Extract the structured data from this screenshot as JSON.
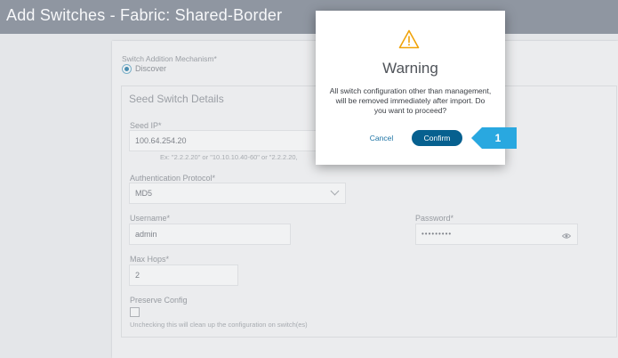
{
  "header": {
    "title": "Add Switches - Fabric: Shared-Border"
  },
  "form": {
    "mechanism_label": "Switch Addition Mechanism*",
    "mechanism_option": "Discover",
    "section_title": "Seed Switch Details",
    "seed_ip_label": "Seed IP*",
    "seed_ip_value": "100.64.254.20",
    "seed_ip_hint": "Ex: \"2.2.2.20\" or \"10.10.10.40-60\" or \"2.2.2.20,",
    "auth_label": "Authentication Protocol*",
    "auth_value": "MD5",
    "username_label": "Username*",
    "username_value": "admin",
    "password_label": "Password*",
    "password_value": "•••••••••",
    "max_hops_label": "Max Hops*",
    "max_hops_value": "2",
    "preserve_label": "Preserve Config",
    "preserve_checked": false,
    "preserve_hint": "Unchecking this will clean up the configuration on switch(es)"
  },
  "dialog": {
    "title": "Warning",
    "message": "All switch configuration other than management, will be removed immediately after import. Do you want to proceed?",
    "cancel_label": "Cancel",
    "confirm_label": "Confirm"
  },
  "callout": {
    "number": "1"
  },
  "colors": {
    "header_bg": "#8f96a1",
    "primary_button": "#06608f",
    "link": "#1e74a5",
    "warning": "#f0a30a",
    "callout": "#29a8e0"
  }
}
